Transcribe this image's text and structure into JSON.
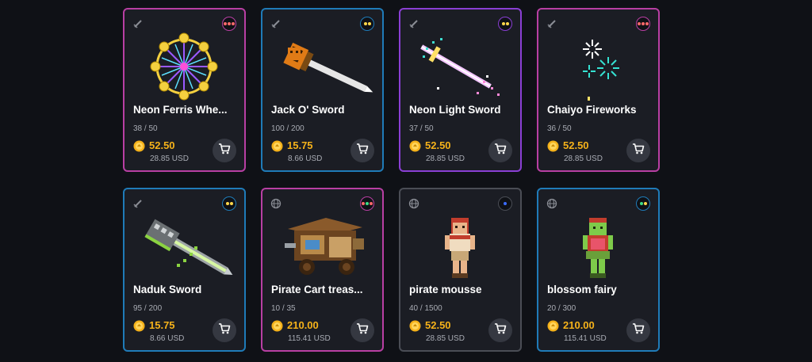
{
  "colors": {
    "background": "#0f1116",
    "card": "#1b1d24",
    "price": "#f5b21a",
    "border_pink": "#b83fa3",
    "border_blue": "#1f7bb8",
    "border_purple": "#8a3fd4",
    "border_gray": "#4a4d55"
  },
  "items": [
    {
      "name": "Neon Ferris Whe...",
      "supply": "38 / 50",
      "price": "52.50",
      "usd": "28.85 USD",
      "type_icon": "sword-icon",
      "rarity_dots": [
        "#ff6a6a",
        "#ff6a6a",
        "#ff6a6a"
      ],
      "frame": "pink",
      "art": "ferris-wheel"
    },
    {
      "name": "Jack O' Sword",
      "supply": "100 / 200",
      "price": "15.75",
      "usd": "8.66 USD",
      "type_icon": "sword-icon",
      "rarity_dots": [
        "#ffd84a",
        "#ffd84a"
      ],
      "frame": "blue",
      "art": "jack-sword"
    },
    {
      "name": "Neon Light Sword",
      "supply": "37 / 50",
      "price": "52.50",
      "usd": "28.85 USD",
      "type_icon": "sword-icon",
      "rarity_dots": [
        "#ffd84a",
        "#ffd84a"
      ],
      "frame": "purple",
      "art": "neon-sword"
    },
    {
      "name": "Chaiyo Fireworks",
      "supply": "36 / 50",
      "price": "52.50",
      "usd": "28.85 USD",
      "type_icon": "sword-icon",
      "rarity_dots": [
        "#ff6a6a",
        "#ff6a6a",
        "#ff6a6a"
      ],
      "frame": "pink",
      "art": "fireworks"
    },
    {
      "name": "Naduk Sword",
      "supply": "95 / 200",
      "price": "15.75",
      "usd": "8.66 USD",
      "type_icon": "sword-icon",
      "rarity_dots": [
        "#ffd84a",
        "#ffd84a"
      ],
      "frame": "blue",
      "art": "naduk-sword"
    },
    {
      "name": "Pirate Cart treas...",
      "supply": "10 / 35",
      "price": "210.00",
      "usd": "115.41 USD",
      "type_icon": "lantern-icon",
      "rarity_dots": [
        "#ff6a6a",
        "#3ddc84",
        "#ff6a6a"
      ],
      "frame": "pink",
      "art": "pirate-cart"
    },
    {
      "name": "pirate mousse",
      "supply": "40 / 1500",
      "price": "52.50",
      "usd": "28.85 USD",
      "type_icon": "lantern-icon",
      "rarity_dots": [
        "#3b6cff"
      ],
      "frame": "gray",
      "art": "pirate-mousse"
    },
    {
      "name": "blossom fairy",
      "supply": "20 / 300",
      "price": "210.00",
      "usd": "115.41 USD",
      "type_icon": "lantern-icon",
      "rarity_dots": [
        "#3ddc84",
        "#ffd84a"
      ],
      "frame": "blue",
      "art": "blossom-fairy"
    }
  ],
  "icons": {
    "coin": "coin-icon",
    "cart": "cart-icon"
  }
}
